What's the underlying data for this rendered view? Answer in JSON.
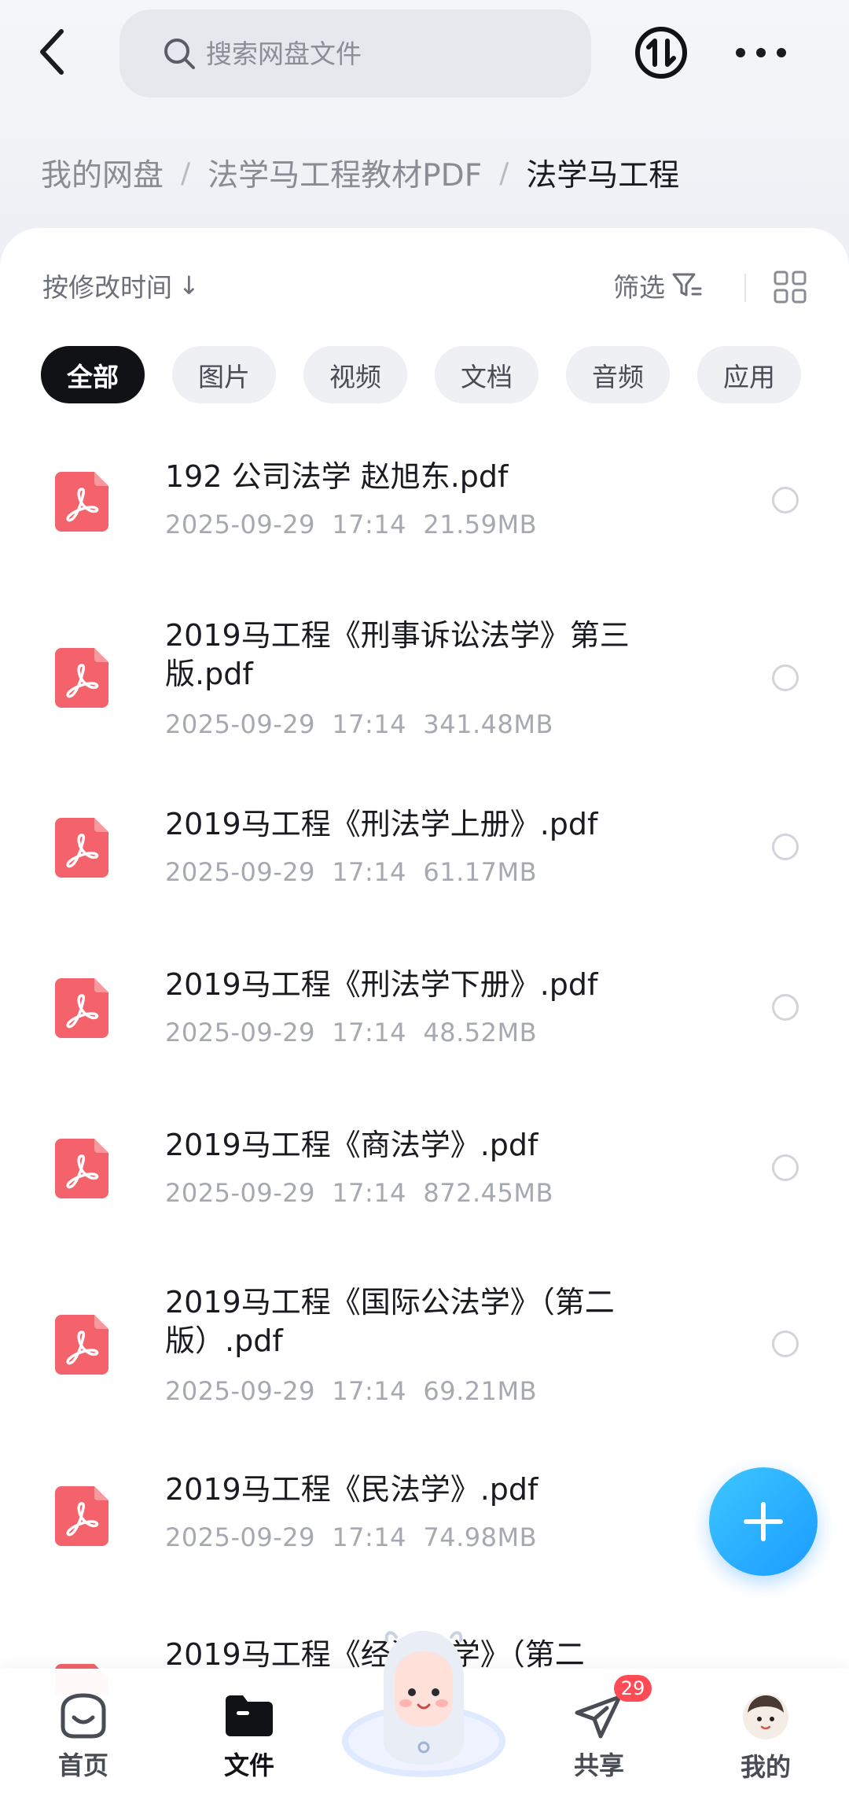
{
  "search": {
    "placeholder": "搜索网盘文件"
  },
  "breadcrumb": {
    "root": "我的网盘",
    "parent": "法学马工程教材PDF",
    "current": "法学马工程"
  },
  "toolbar": {
    "sort_label": "按修改时间",
    "sort_arrow": "↓",
    "filter_label": "筛选"
  },
  "chips": [
    "全部",
    "图片",
    "视频",
    "文档",
    "音频",
    "应用"
  ],
  "files": [
    {
      "name": "192   公司法学 赵旭东.pdf",
      "date": "2025-09-29",
      "time": "17:14",
      "size": "21.59MB"
    },
    {
      "name": "2019马工程《刑事诉讼法学》第三版.pdf",
      "date": "2025-09-29",
      "time": "17:14",
      "size": "341.48MB"
    },
    {
      "name": "2019马工程《刑法学上册》.pdf",
      "date": "2025-09-29",
      "time": "17:14",
      "size": "61.17MB"
    },
    {
      "name": "2019马工程《刑法学下册》.pdf",
      "date": "2025-09-29",
      "time": "17:14",
      "size": "48.52MB"
    },
    {
      "name": "2019马工程《商法学》.pdf",
      "date": "2025-09-29",
      "time": "17:14",
      "size": "872.45MB"
    },
    {
      "name": "2019马工程《国际公法学》（第二版）.pdf",
      "date": "2025-09-29",
      "time": "17:14",
      "size": "69.21MB"
    },
    {
      "name": "2019马工程《民法学》.pdf",
      "date": "2025-09-29",
      "time": "17:14",
      "size": "74.98MB"
    },
    {
      "name": "2019马工程《经济法学》（第二",
      "date": "",
      "time": "",
      "size": ""
    }
  ],
  "nav": {
    "home": "首页",
    "files": "文件",
    "share": "共享",
    "me": "我的",
    "share_badge": "29"
  },
  "colors": {
    "pdf_red": "#f4636b",
    "fab_blue": "#1a9bff",
    "badge_red": "#ff4b55"
  }
}
